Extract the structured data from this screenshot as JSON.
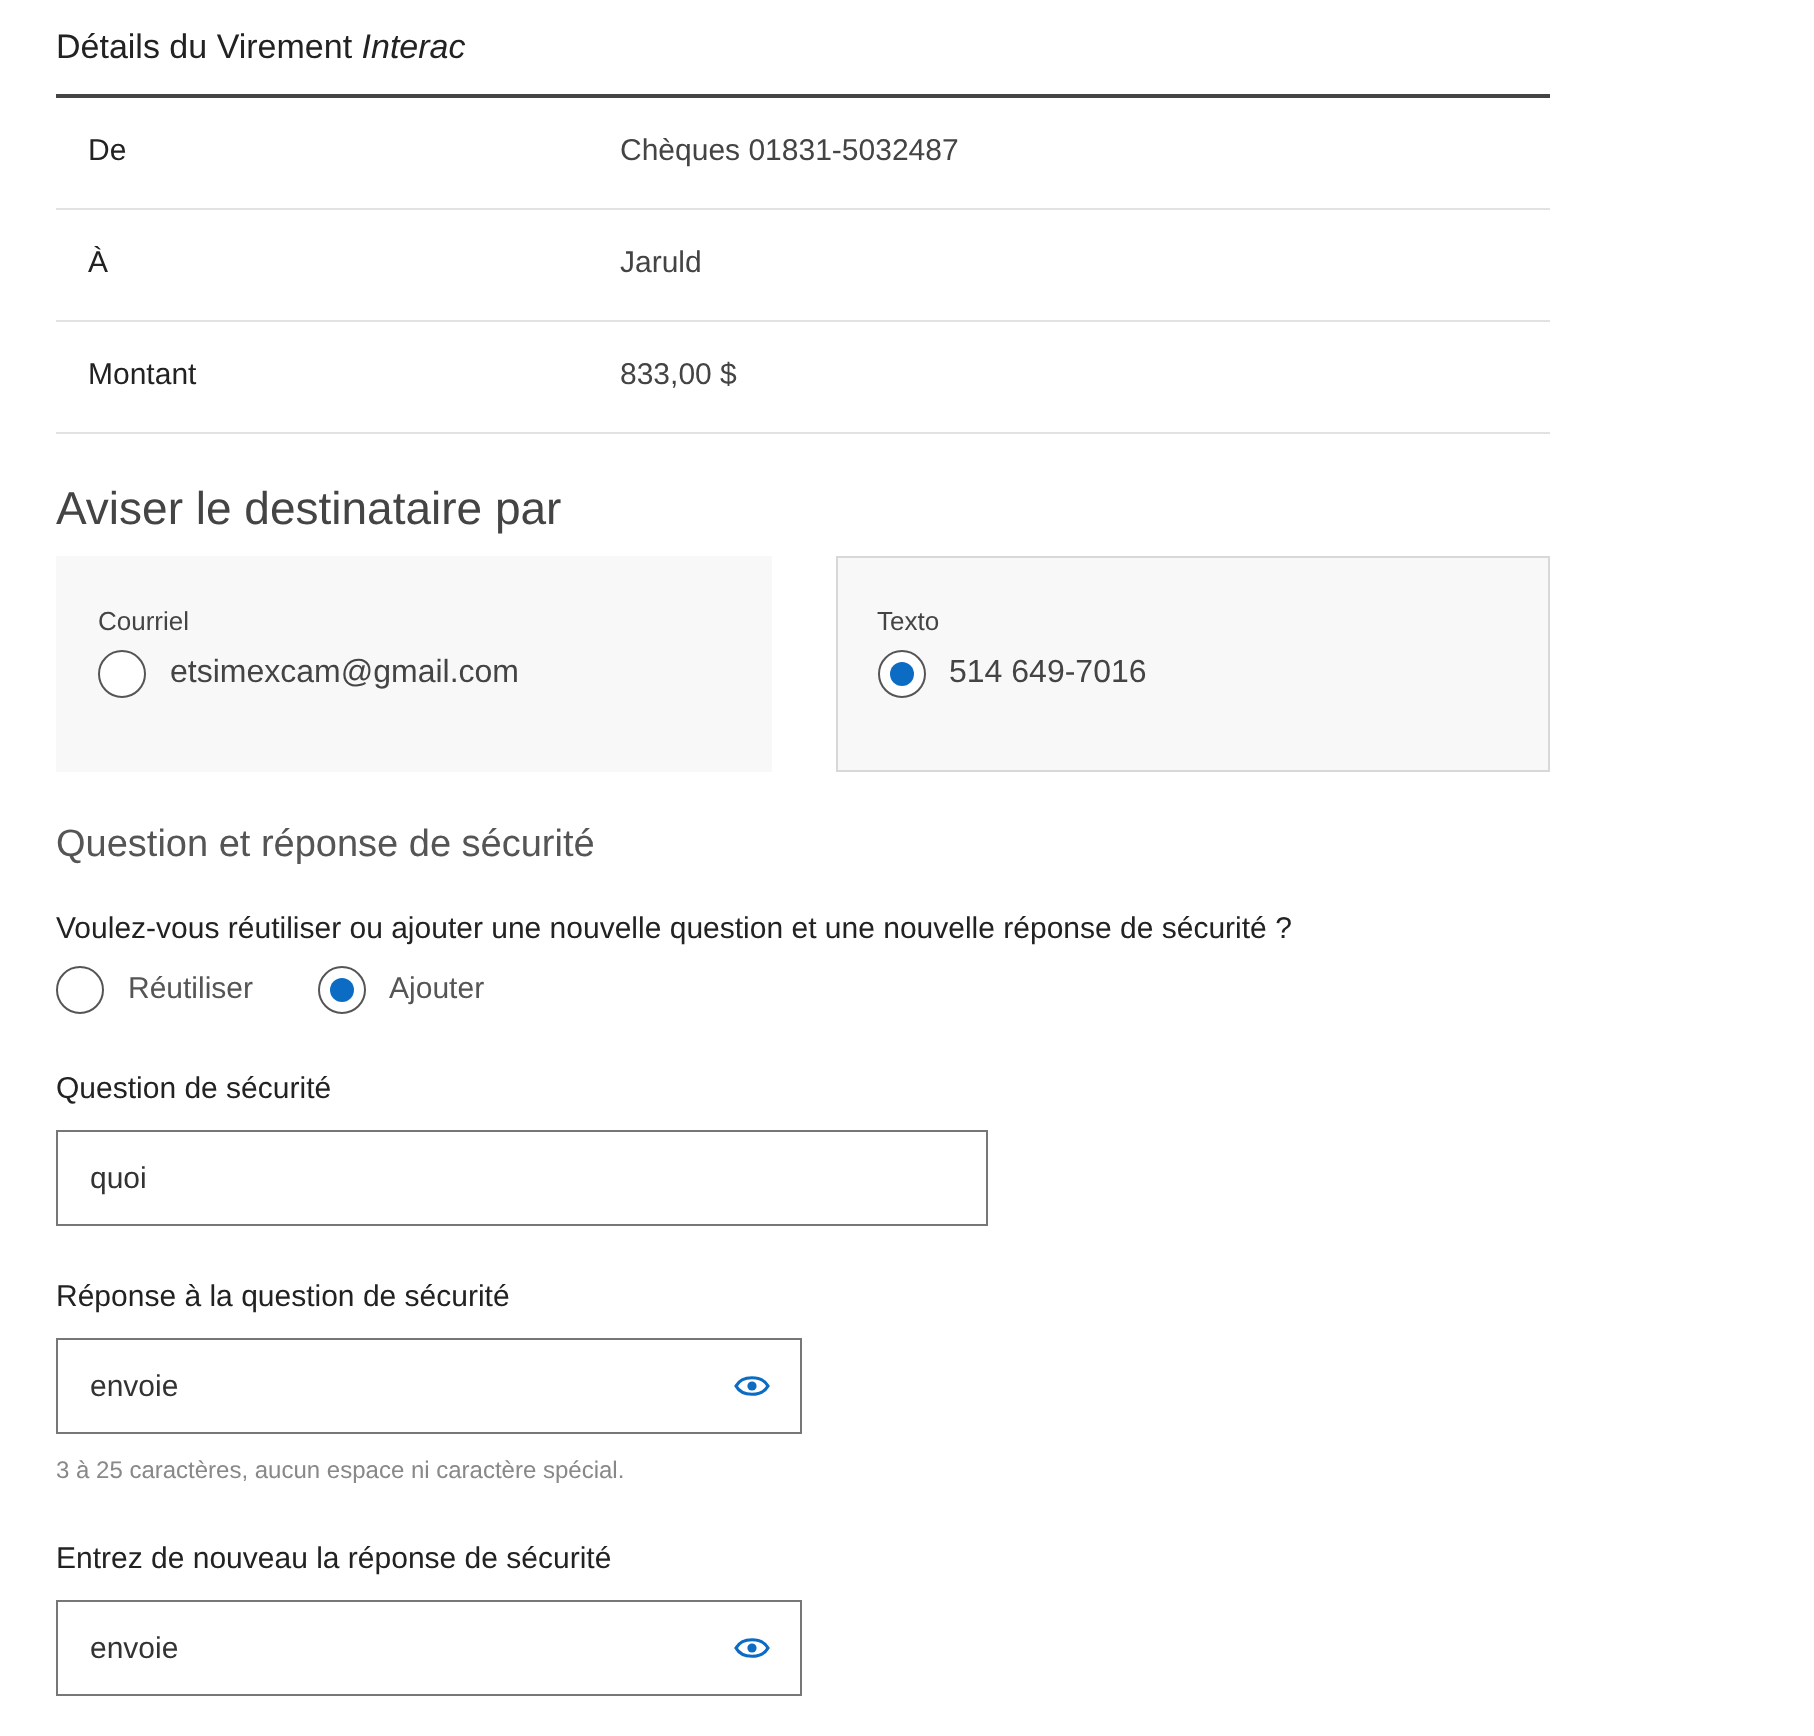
{
  "details": {
    "title": "Détails du Virement *Interac*",
    "rows": [
      {
        "label": "De",
        "value": "Chèques 01831-5032487"
      },
      {
        "label": "À",
        "value": "Jaruld"
      },
      {
        "label": "Montant",
        "value": "833,00 $"
      }
    ]
  },
  "notify": {
    "title": "Aviser le destinataire par",
    "options": [
      {
        "label": "Courriel",
        "value": "etsimexcam@gmail.com",
        "selected": false
      },
      {
        "label": "Texto",
        "value": "514 649-7016",
        "selected": true
      }
    ]
  },
  "security": {
    "title": "Question et réponse de sécurité",
    "prompt": "Voulez-vous réutiliser ou ajouter une nouvelle question et une nouvelle réponse de sécurité ?",
    "choices": [
      {
        "label": "Réutiliser",
        "selected": false
      },
      {
        "label": "Ajouter",
        "selected": true
      }
    ],
    "fields": [
      {
        "kind": "text",
        "label": "Question de sécurité",
        "value": "quoi"
      },
      {
        "kind": "secret",
        "label": "Réponse à la question de sécurité",
        "value": "envoie",
        "hint": "3 à 25 caractères, aucun espace ni caractère spécial."
      },
      {
        "kind": "secret",
        "label": "Entrez de nouveau la réponse de sécurité",
        "value": "envoie"
      }
    ]
  }
}
